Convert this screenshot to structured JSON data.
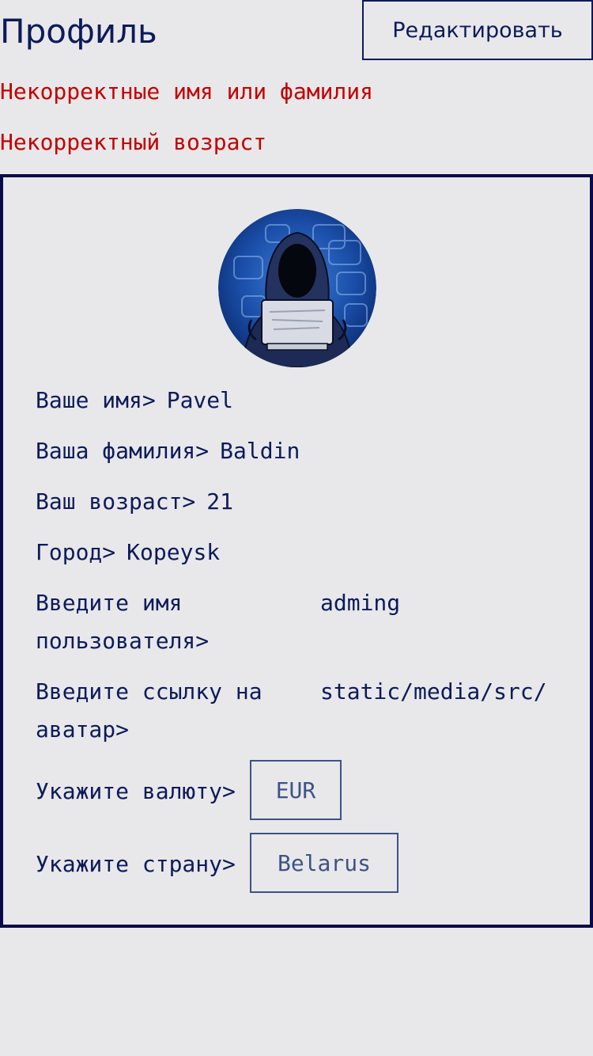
{
  "header": {
    "title": "Профиль",
    "edit_label": "Редактировать"
  },
  "errors": [
    "Некорректные имя или фамилия",
    "Некорректный возраст"
  ],
  "profile": {
    "avatar_icon": "hacker-avatar-icon",
    "first_name": {
      "label": "Ваше имя>",
      "value": "Pavel"
    },
    "last_name": {
      "label": "Ваша фамилия>",
      "value": "Baldin"
    },
    "age": {
      "label": "Ваш возраст>",
      "value": "21"
    },
    "city": {
      "label": "Город>",
      "value": "Kopeysk"
    },
    "username": {
      "label": "Введите имя пользователя>",
      "value": "adming"
    },
    "avatar_link": {
      "label": "Введите ссылку на аватар>",
      "value": "static/media/src/"
    },
    "currency": {
      "label": "Укажите валюту>",
      "value": "EUR"
    },
    "country": {
      "label": "Укажите страну>",
      "value": "Belarus"
    }
  },
  "colors": {
    "background": "#e8e8ea",
    "text": "#0d1a5a",
    "error": "#c40000",
    "border": "#0a0a4a",
    "select_border": "#3e5288"
  }
}
